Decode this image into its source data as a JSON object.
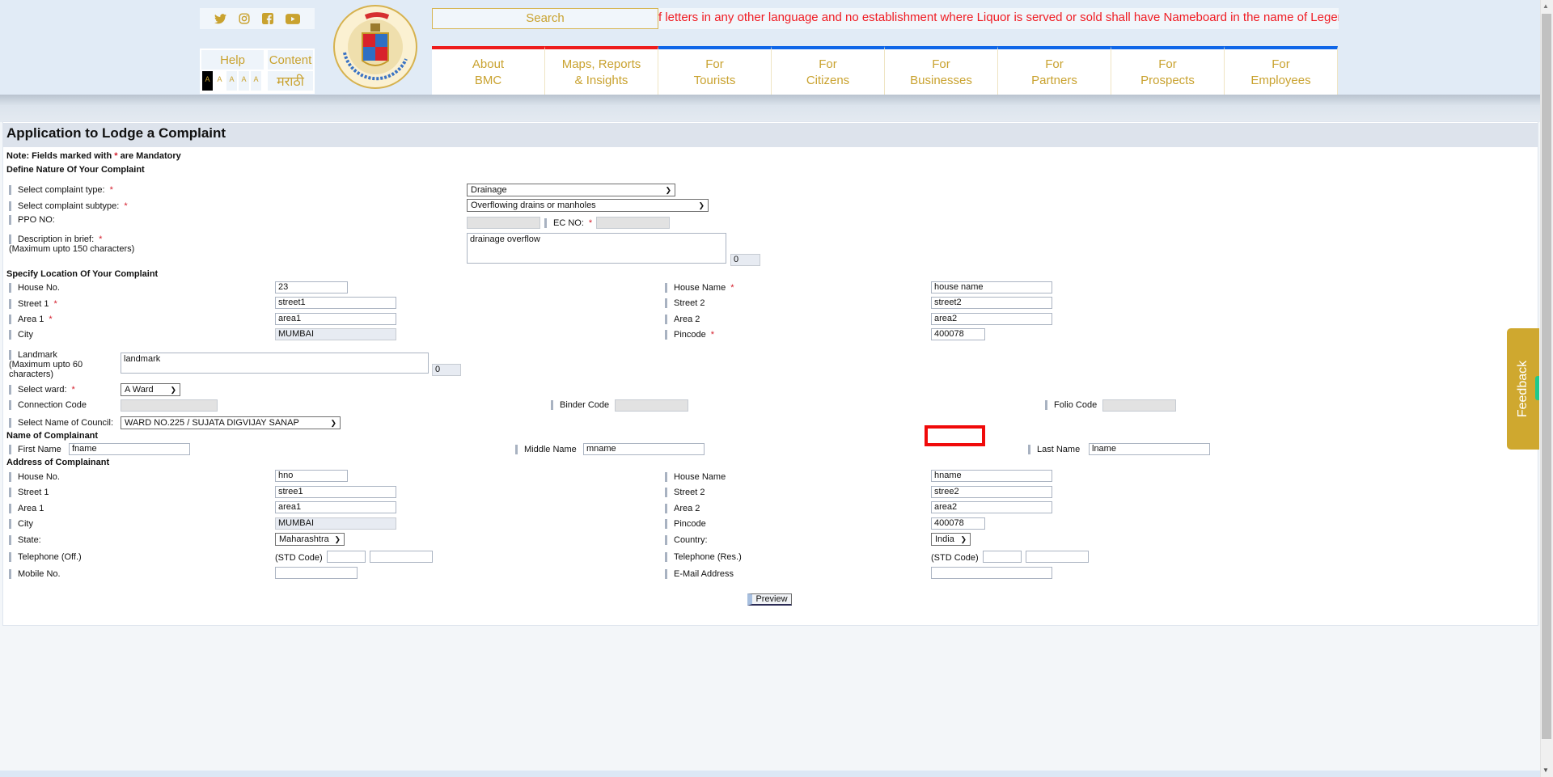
{
  "header": {
    "social_icons": [
      "twitter-icon",
      "instagram-icon",
      "facebook-icon",
      "youtube-icon"
    ],
    "help_label": "Help",
    "content_label": "Content",
    "font_size_buttons": [
      "A",
      "A",
      "A",
      "A",
      "A"
    ],
    "font_size_button_marks": [
      "",
      "",
      "-",
      "",
      "+"
    ],
    "language_label": "मराठी",
    "logo_alt": "Brihanmumbai Municipal Corporation",
    "search_placeholder": "Search",
    "ticker_text": "f letters in any other language and no establishment where Liquor is served or sold shall have Nameboard in the name of Legends or F",
    "nav": [
      {
        "line1": "About",
        "line2": "BMC",
        "accent": "#ee1c1c"
      },
      {
        "line1": "Maps, Reports",
        "line2": "& Insights",
        "accent": "#ee1c1c"
      },
      {
        "line1": "For",
        "line2": "Tourists",
        "accent": "#0f66e8"
      },
      {
        "line1": "For",
        "line2": "Citizens",
        "accent": "#0f66e8"
      },
      {
        "line1": "For",
        "line2": "Businesses",
        "accent": "#0f66e8"
      },
      {
        "line1": "For",
        "line2": "Partners",
        "accent": "#0f66e8"
      },
      {
        "line1": "For",
        "line2": "Prospects",
        "accent": "#0f66e8"
      },
      {
        "line1": "For",
        "line2": "Employees",
        "accent": "#0f66e8"
      }
    ]
  },
  "form": {
    "title": "Application to Lodge a Complaint",
    "note_prefix": "Note: Fields marked with ",
    "note_star": "*",
    "note_suffix": " are Mandatory",
    "required_mark": "*",
    "sections": {
      "nature": "Define Nature Of Your Complaint",
      "location": "Specify Location Of Your Complaint",
      "name": "Name of Complainant",
      "address": "Address of Complainant"
    },
    "nature": {
      "complaint_type_label": "Select complaint type:",
      "complaint_type_value": "Drainage",
      "complaint_subtype_label": "Select complaint subtype:",
      "complaint_subtype_value": "Overflowing drains or manholes",
      "ppo_label": "PPO NO:",
      "ppo_value": "",
      "ec_label": "EC NO:",
      "ec_value": "",
      "description_label": "Description in brief:",
      "description_hint": "(Maximum upto 150 characters)",
      "description_value": "drainage overflow",
      "description_counter": "0"
    },
    "location": {
      "house_no_label": "House No.",
      "house_no_value": "23",
      "house_name_label": "House Name",
      "house_name_value": "house name",
      "street1_label": "Street 1",
      "street1_value": "street1",
      "street2_label": "Street 2",
      "street2_value": "street2",
      "area1_label": "Area 1",
      "area1_value": "area1",
      "area2_label": "Area 2",
      "area2_value": "area2",
      "city_label": "City",
      "city_value": "MUMBAI",
      "pincode_label": "Pincode",
      "pincode_value": "400078",
      "landmark_label": "Landmark",
      "landmark_hint_1": "(Maximum upto 60",
      "landmark_hint_2": "characters)",
      "landmark_value": "landmark",
      "landmark_counter": "0",
      "ward_label": "Select ward:",
      "ward_value": "A Ward",
      "connection_code_label": "Connection Code",
      "binder_code_label": "Binder Code",
      "folio_code_label": "Folio Code",
      "council_label": "Select Name of Council:",
      "council_value": "WARD NO.225 / SUJATA DIGVIJAY SANAP"
    },
    "name": {
      "first_name_label": "First Name",
      "first_name_value": "fname",
      "middle_name_label": "Middle Name",
      "middle_name_value": "mname",
      "last_name_label": "Last Name",
      "last_name_value": "lname"
    },
    "address": {
      "house_no_label": "House No.",
      "house_no_value": "hno",
      "house_name_label": "House Name",
      "house_name_value": "hname",
      "street1_label": "Street 1",
      "street1_value": "stree1",
      "street2_label": "Street 2",
      "street2_value": "stree2",
      "area1_label": "Area 1",
      "area1_value": "area1",
      "area2_label": "Area 2",
      "area2_value": "area2",
      "city_label": "City",
      "city_value": "MUMBAI",
      "pincode_label": "Pincode",
      "pincode_value": "400078",
      "state_label": "State:",
      "state_value": "Maharashtra",
      "country_label": "Country:",
      "country_value": "India",
      "tel_off_label": "Telephone (Off.)",
      "tel_res_label": "Telephone (Res.)",
      "std_code_label": "(STD Code)",
      "mobile_label": "Mobile No.",
      "email_label": "E-Mail Address"
    },
    "preview_button": "Preview"
  },
  "feedback_label": "Feedback",
  "colors": {
    "gold": "#c9a22f",
    "ticker_red": "#f01c23",
    "required_red": "#d41d2b",
    "highlight_red": "#f00a0a",
    "feedback_bg": "#cfa82f"
  }
}
